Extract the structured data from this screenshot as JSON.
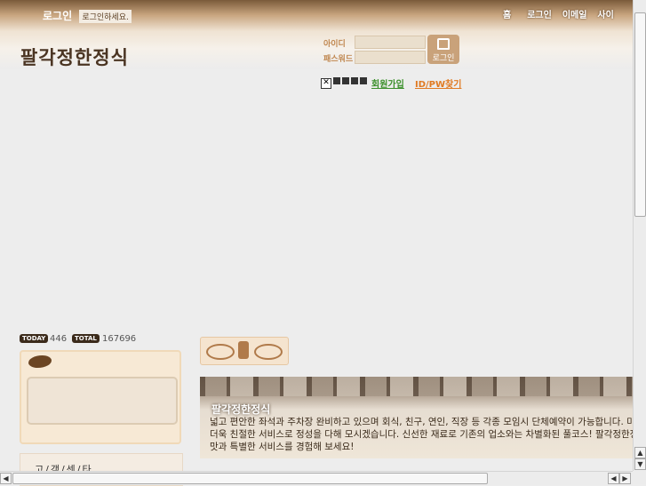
{
  "header": {
    "login_tab": "로그인",
    "login_tab_sub": "로그인하세요.",
    "nav": [
      "홈",
      "로그인",
      "이메일",
      "사이"
    ],
    "site_title": "팔각정한정식"
  },
  "login_form": {
    "id_label": "아이디",
    "pw_label": "패스워드",
    "button_label": "로그인",
    "broken_image": "✕",
    "join_link": "회원가입",
    "find_link": "ID/PW찾기"
  },
  "counter": {
    "today_label": "TODAY",
    "today_value": "446",
    "total_label": "TOTAL",
    "total_value": "167696"
  },
  "left_panel": {
    "menu_label": "고/객/센/타"
  },
  "banner": {
    "title": "팔각정한정식",
    "line1": "넓고 편안한 좌석과 주차장 완비하고 있으며 회식, 친구, 연인, 직장 등 각종 모임시 단체예약이 가능합니다. 미",
    "line2": "더욱 친절한 서비스로 정성을 다해 모시겠습니다. 신선한 재료로 기존의 업소와는 차별화된 풀코스! 팔각정한정",
    "line3": "맛과 특별한 서비스를 경험해 보세요!"
  },
  "scrollbars": {
    "up": "▲",
    "down": "▼",
    "left": "◀",
    "right": "▶"
  }
}
